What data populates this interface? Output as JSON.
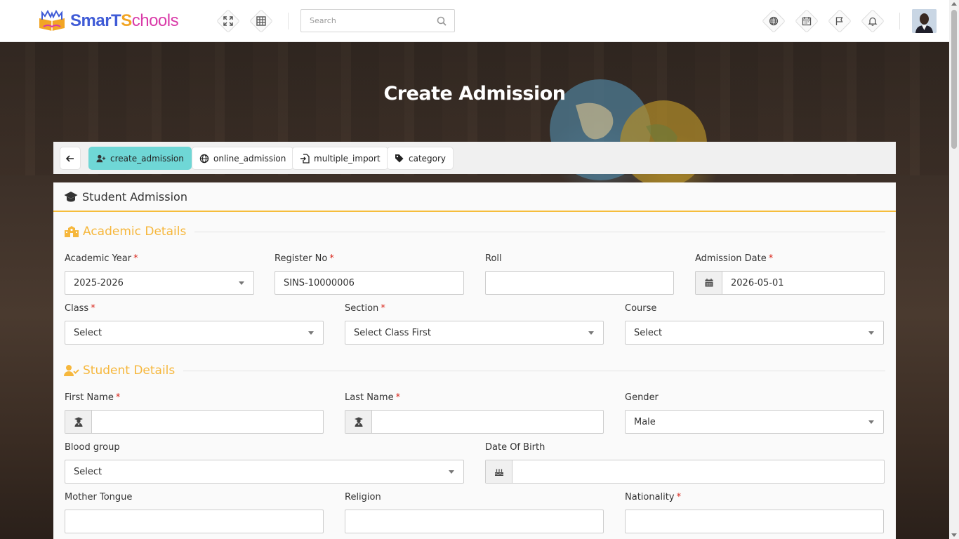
{
  "topbar": {
    "logo": {
      "part1": "SmarT",
      "part2": "S",
      "part3": "chools"
    },
    "search_placeholder": "Search",
    "icons": [
      "fullscreen-icon",
      "grid-icon",
      "globe-icon",
      "calendar-icon",
      "flag-icon",
      "bell-icon"
    ]
  },
  "hero": {
    "title": "Create Admission"
  },
  "tabs": [
    {
      "label": "create_admission",
      "icon": "user-plus-icon",
      "active": true
    },
    {
      "label": "online_admission",
      "icon": "globe-icon",
      "active": false
    },
    {
      "label": "multiple_import",
      "icon": "file-import-icon",
      "active": false
    },
    {
      "label": "category",
      "icon": "tags-icon",
      "active": false
    }
  ],
  "panel": {
    "title": "Student Admission",
    "academic": {
      "title": "Academic Details",
      "academic_year": {
        "label": "Academic Year",
        "value": "2025-2026"
      },
      "register_no": {
        "label": "Register No",
        "value": "SINS-10000006"
      },
      "roll": {
        "label": "Roll",
        "value": ""
      },
      "admission_date": {
        "label": "Admission Date",
        "value": "2026-05-01"
      },
      "class": {
        "label": "Class",
        "value": "Select"
      },
      "section": {
        "label": "Section",
        "value": "Select Class First"
      },
      "course": {
        "label": "Course",
        "value": "Select"
      }
    },
    "student": {
      "title": "Student Details",
      "first_name": {
        "label": "First Name",
        "value": ""
      },
      "last_name": {
        "label": "Last Name",
        "value": ""
      },
      "gender": {
        "label": "Gender",
        "value": "Male"
      },
      "blood_group": {
        "label": "Blood group",
        "value": "Select"
      },
      "dob": {
        "label": "Date Of Birth",
        "value": ""
      },
      "mother_tongue": {
        "label": "Mother Tongue",
        "value": ""
      },
      "religion": {
        "label": "Religion",
        "value": ""
      },
      "nationality": {
        "label": "Nationality",
        "value": ""
      }
    },
    "required_mark": "*"
  },
  "colors": {
    "accent": "#f6b73c",
    "active_tab": "#6fd7d6",
    "required": "#d9271c"
  }
}
